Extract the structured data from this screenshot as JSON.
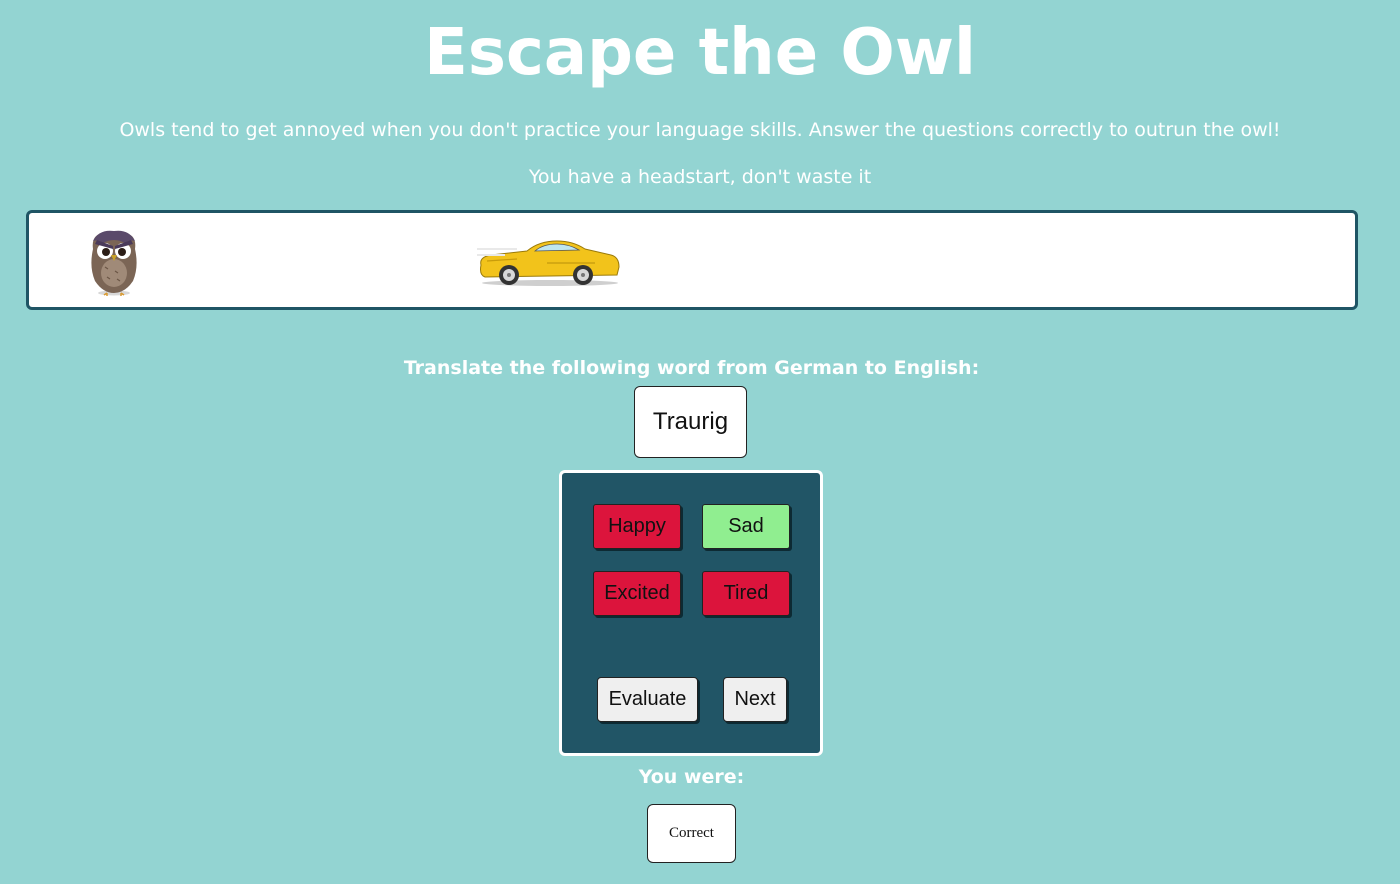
{
  "header": {
    "title": "Escape the Owl",
    "intro": "Owls tend to get annoyed when you don't practice your language skills. Answer the questions correctly to outrun the owl!",
    "headstart": "You have a headstart, don't waste it"
  },
  "track": {
    "owl_icon": "owl-icon",
    "car_icon": "car-icon"
  },
  "quiz": {
    "prompt": "Translate the following word from German to English:",
    "word": "Traurig",
    "choices": [
      {
        "label": "Happy",
        "state": "wrong",
        "color": "#dc143c"
      },
      {
        "label": "Sad",
        "state": "correct",
        "color": "#90ee90"
      },
      {
        "label": "Excited",
        "state": "wrong",
        "color": "#dc143c"
      },
      {
        "label": "Tired",
        "state": "wrong",
        "color": "#dc143c"
      }
    ],
    "evaluate_label": "Evaluate",
    "next_label": "Next"
  },
  "result": {
    "label": "You were:",
    "value": "Correct"
  },
  "colors": {
    "background": "#93d4d2",
    "panel": "#215566",
    "wrong": "#dc143c",
    "correct": "#90ee90"
  }
}
